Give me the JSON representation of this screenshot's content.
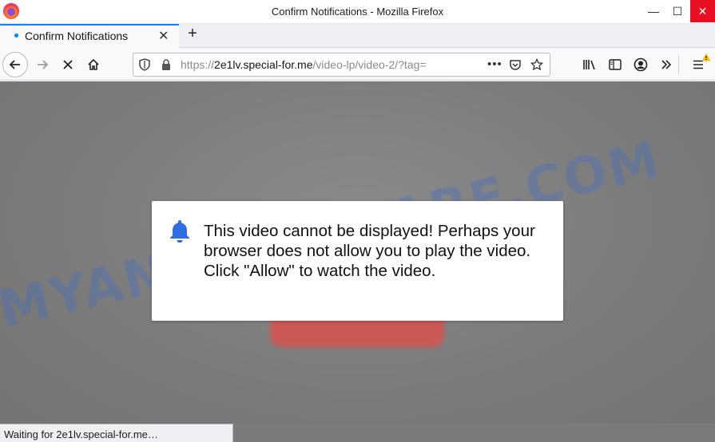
{
  "window": {
    "title": "Confirm Notifications - Mozilla Firefox",
    "controls": {
      "minimize": "—",
      "maximize": "☐",
      "close": "✕"
    }
  },
  "tabs": [
    {
      "label": "Confirm Notifications",
      "active": true
    }
  ],
  "toolbar": {
    "new_tab": "+",
    "url_prefix": "https://",
    "url_domain": "2e1lv.special-for.me",
    "url_path": "/video-lp/video-2/?tag=",
    "page_actions": "•••",
    "icons": [
      "back-icon",
      "forward-icon",
      "stop-icon",
      "home-icon",
      "shield-icon",
      "lock-icon",
      "pocket-icon",
      "star-icon",
      "library-icon",
      "sidebar-icon",
      "account-icon",
      "overflow-icon",
      "menu-icon",
      "warning-icon"
    ],
    "accent": "#0a84ff"
  },
  "dialog": {
    "message": "This video cannot be displayed! Perhaps your browser does not allow you to play the video. Click \"Allow\" to watch the video.",
    "icon": "bell-icon",
    "icon_color": "#2f6ee0"
  },
  "watermark": "MYANTISPYWARE.COM",
  "status": "Waiting for 2e1lv.special-for.me…"
}
